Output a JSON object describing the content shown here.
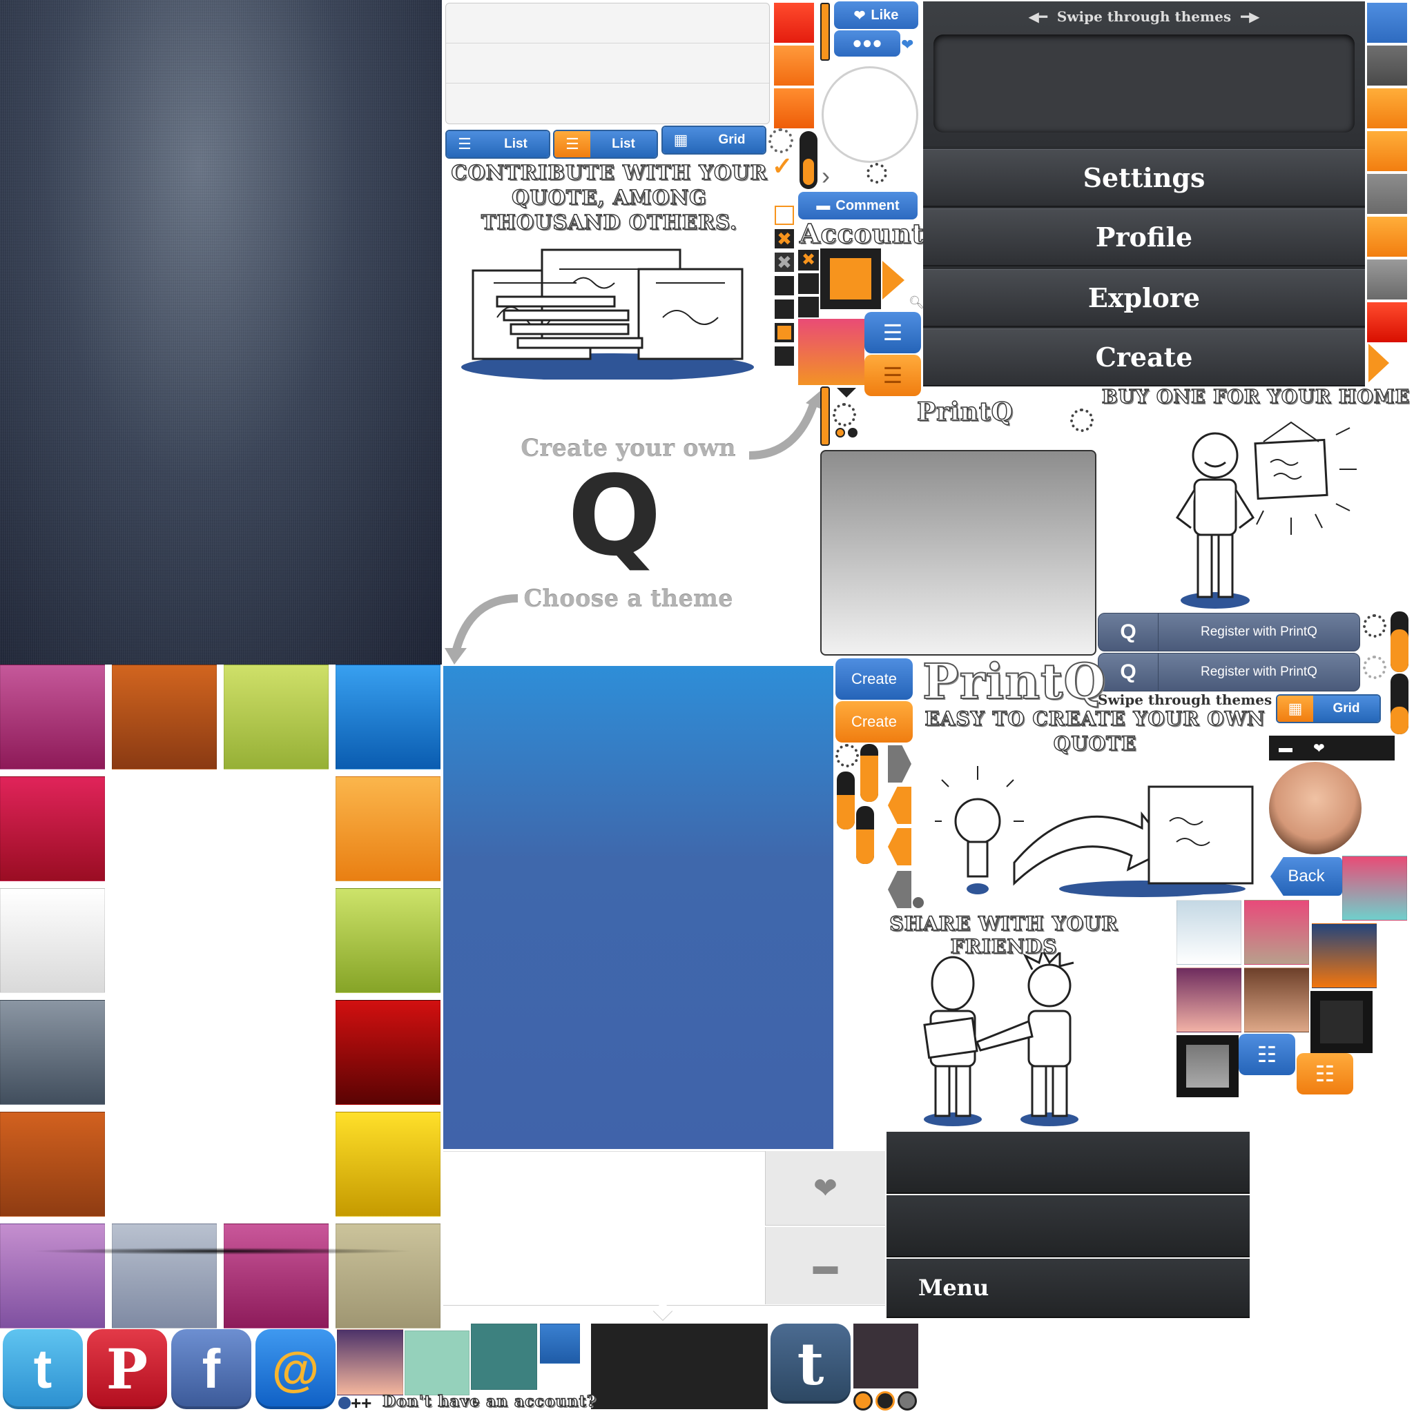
{
  "view_buttons": {
    "list_label": "List",
    "list_orange_label": "List",
    "grid_label": "Grid"
  },
  "social": {
    "like_label": "Like",
    "comment_label": "Comment"
  },
  "promo": {
    "contribute": "CONTRIBUTE WITH YOUR QUOTE, AMONG THOUSAND OTHERS.",
    "create_your_own": "Create your own",
    "choose_theme": "Choose a theme",
    "buy_one": "BUY ONE FOR YOUR HOME",
    "easy_to_create": "EASY TO CREATE YOUR OWN QUOTE",
    "share": "SHARE WITH YOUR FRIENDS",
    "dont_have_account": "Don't have an account?"
  },
  "account_label": "Account",
  "logo": {
    "small": "PrintQ",
    "large": "PrintQ",
    "q_glyph": "Q"
  },
  "menu_panel": {
    "swipe_label": "Swipe through themes",
    "items": [
      "Settings",
      "Profile",
      "Explore",
      "Create"
    ]
  },
  "swipe_small": "Swipe through themes",
  "register": {
    "label1": "Register with PrintQ",
    "label2": "Register with PrintQ",
    "q": "Q"
  },
  "create_buttons": {
    "blue": "Create",
    "orange": "Create"
  },
  "grid_orange_label": "Grid",
  "back_label": "Back",
  "bottom_menu_label": "Menu",
  "social_icons": [
    "twitter-icon",
    "pinterest-icon",
    "facebook-icon",
    "email-icon",
    "tumblr-icon"
  ],
  "social_glyphs": {
    "twitter": "t",
    "pinterest": "P",
    "facebook": "f",
    "email": "@",
    "tumblr": "t"
  },
  "plus_glyphs": "++",
  "colors": {
    "accent_blue": "#2a6bbf",
    "accent_orange": "#f7941d",
    "theme_swatches": {
      "left_column": [
        [
          "#c5589a",
          "#8e1a58"
        ],
        [
          "#e0245a",
          "#9a0d23"
        ],
        [
          "#ffffff",
          "#d9d9d9"
        ],
        [
          "#8b96a3",
          "#414e5d"
        ],
        [
          "#d2611f",
          "#8f3c12"
        ],
        [
          "#c58fcf",
          "#7f50a0"
        ]
      ],
      "top_row": [
        [
          "#d2651f",
          "#8a3a13"
        ],
        [
          "#cfe069",
          "#96b036"
        ],
        [
          "#38a0f0",
          "#0a5cb0"
        ]
      ],
      "right_column": [
        [
          "#fbb64c",
          "#e97f12"
        ],
        [
          "#cde36a",
          "#86a427"
        ],
        [
          "#d21010",
          "#5a0303"
        ],
        [
          "#ffe02a",
          "#c59a00"
        ],
        [
          "#cbc39b",
          "#9f9672"
        ]
      ],
      "bottom_row": [
        [
          "#b9c1cf",
          "#7f8aa3"
        ],
        [
          "#c9579a",
          "#8d1b5a"
        ]
      ],
      "right_grid": [
        [
          "#e94b76",
          "#6fd0cc"
        ],
        [
          "#c4d8e4",
          "#ffffff"
        ],
        [
          "#e84a7a",
          "#b8a08c"
        ],
        [
          "#24457c",
          "#f3760e"
        ],
        [
          "#6e2c5e",
          "#f2b2a6"
        ],
        [
          "#6d402a",
          "#dea888"
        ]
      ],
      "bottom_strip": [
        [
          "#4c3269",
          "#f5b79d"
        ],
        [
          "#95d1bb",
          "#95d1bb"
        ],
        [
          "#3d817f",
          "#3d817f"
        ]
      ]
    }
  }
}
